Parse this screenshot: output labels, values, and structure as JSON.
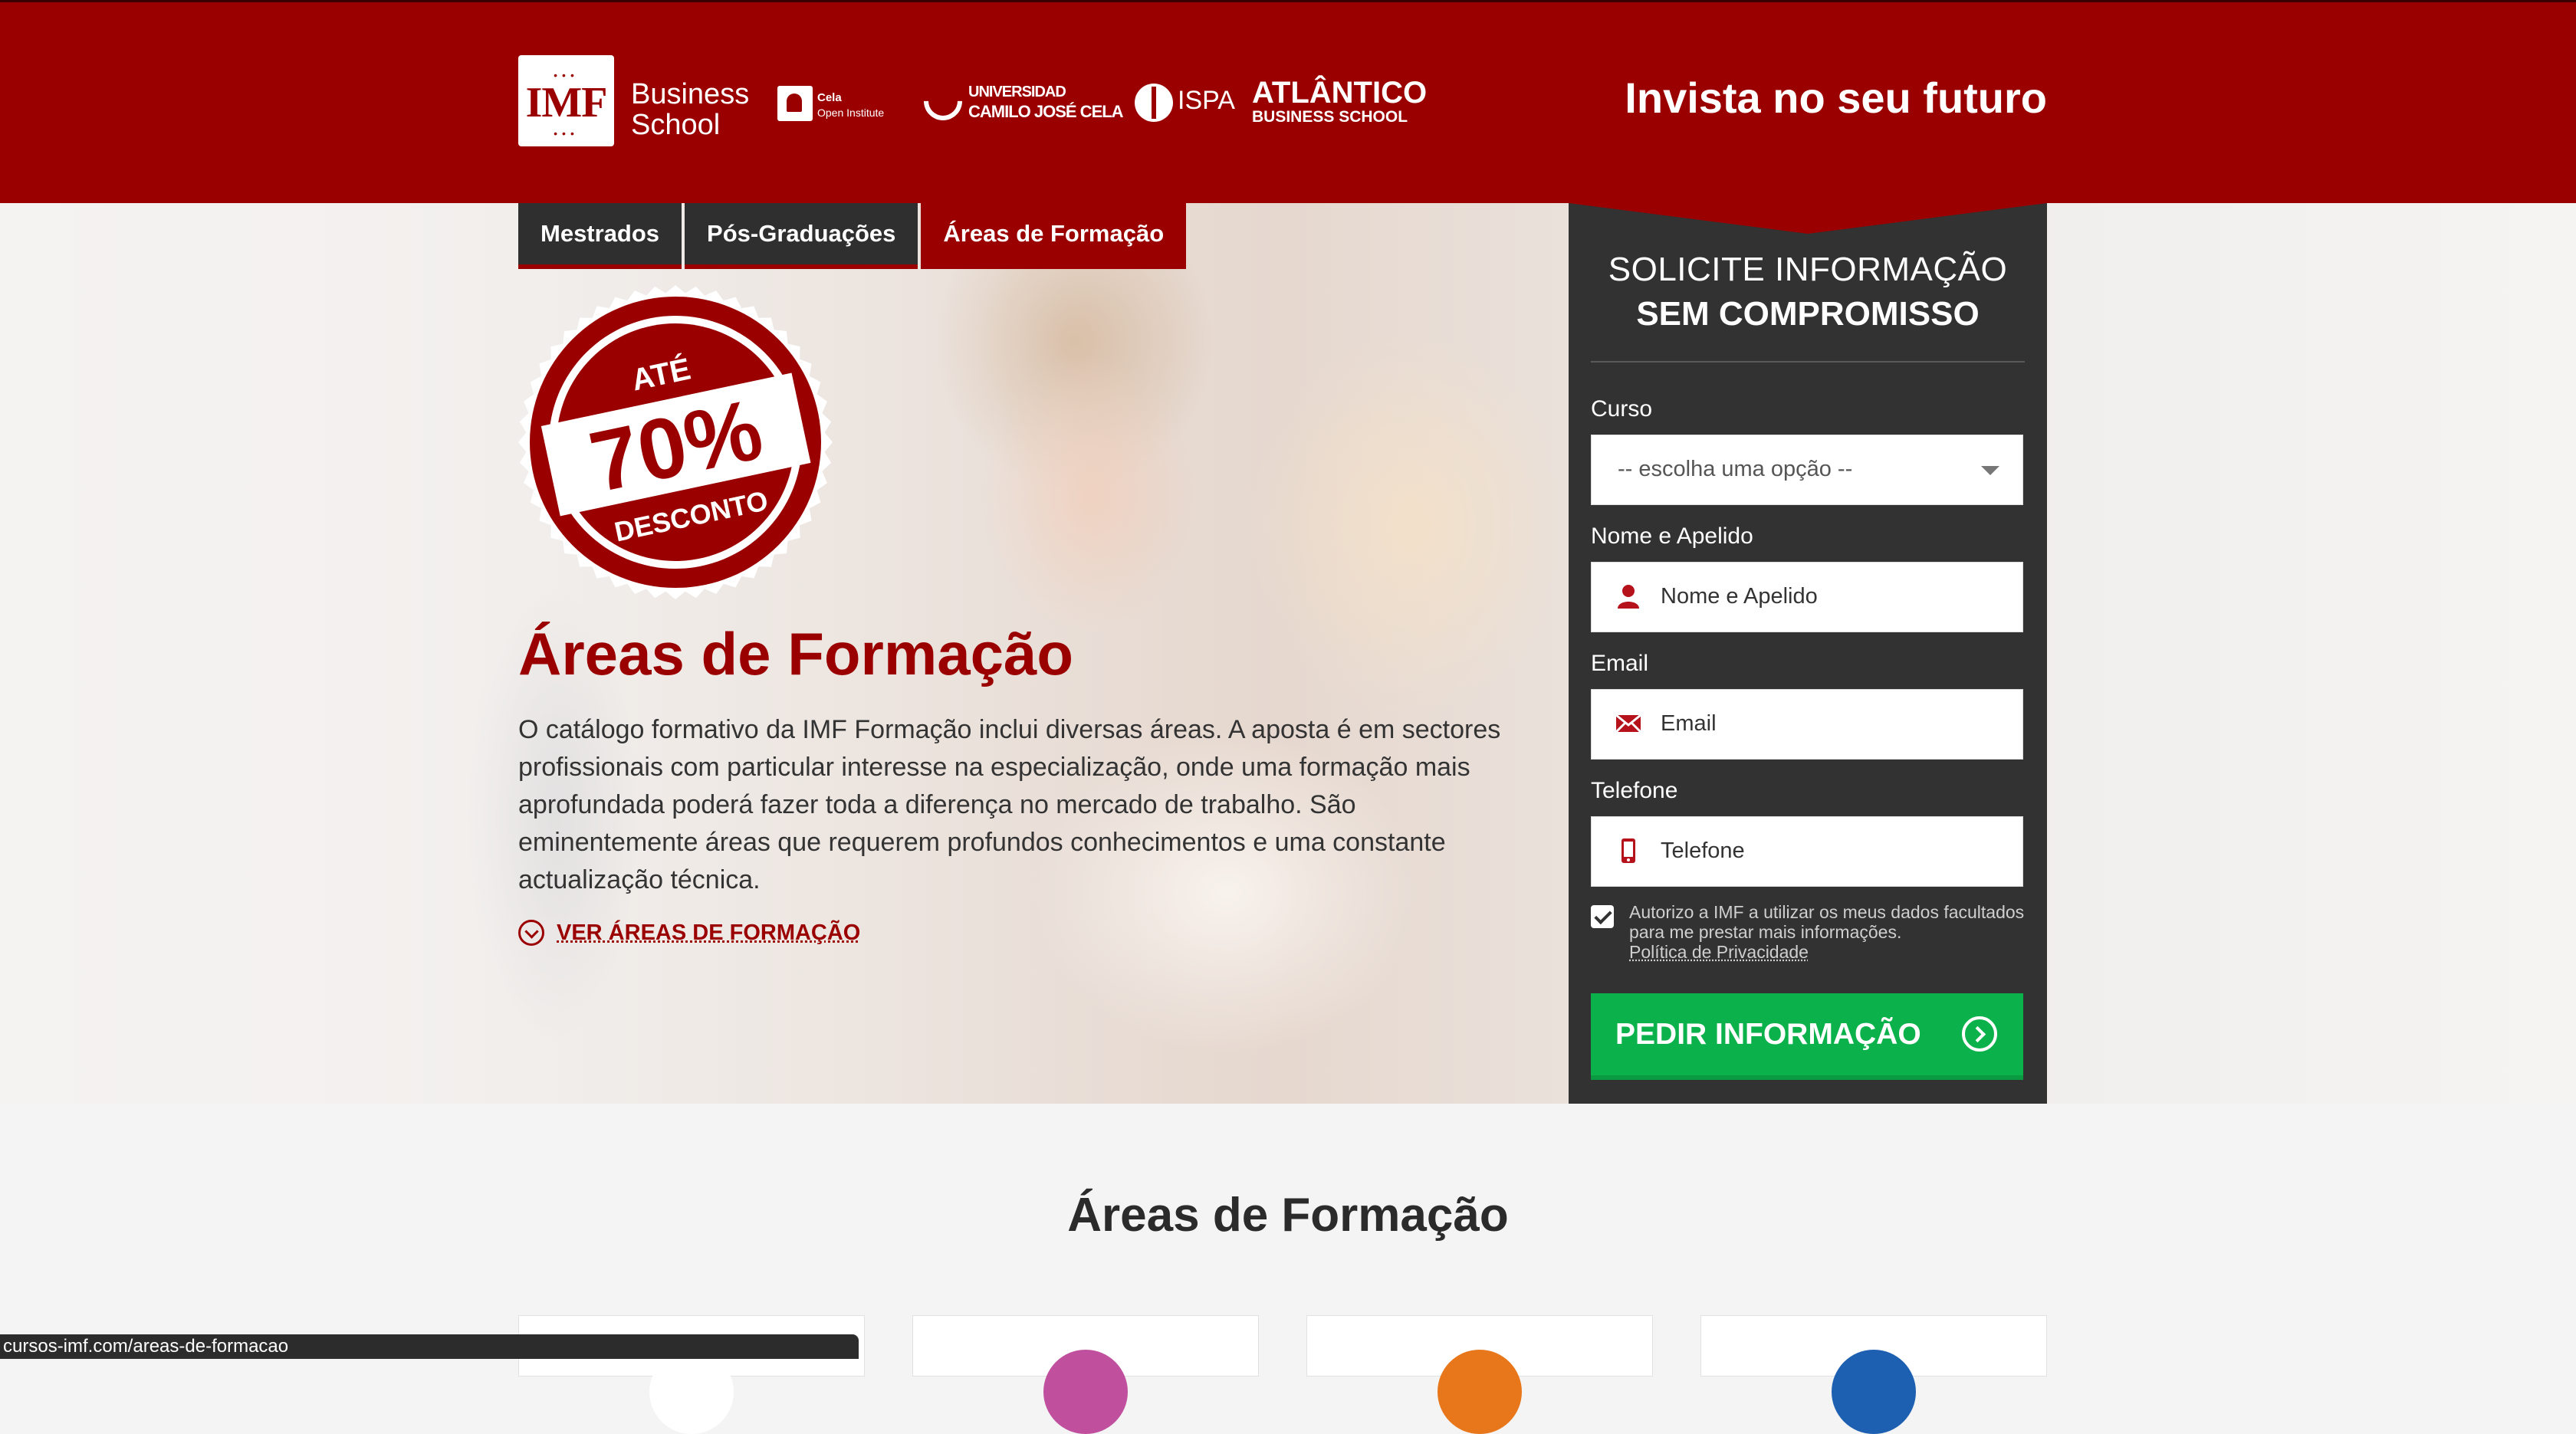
{
  "header": {
    "logos": {
      "imf": "IMF",
      "business_school": [
        "Business",
        "School"
      ],
      "cela": [
        "Cela",
        "Open Institute"
      ],
      "ucjc": [
        "UNIVERSIDAD",
        "CAMILO JOSÉ CELA"
      ],
      "ispa": "ISPA",
      "atlantico": [
        "ATLÂNTICO",
        "BUSINESS SCHOOL"
      ]
    },
    "tagline": "Invista no seu futuro",
    "brand_color": "#9b0000"
  },
  "nav": {
    "tabs": [
      {
        "label": "Mestrados",
        "active": false
      },
      {
        "label": "Pós-Graduações",
        "active": false
      },
      {
        "label": "Áreas de Formação",
        "active": true
      }
    ]
  },
  "badge": {
    "top": "ATÉ",
    "value": "70%",
    "bottom": "DESCONTO"
  },
  "hero": {
    "title": "Áreas de Formação",
    "text": "O catálogo formativo da IMF Formação inclui diversas áreas. A aposta é em sectores profissionais com particular interesse na especialização, onde uma formação mais aprofundada poderá fazer toda a diferença no mercado de trabalho. São eminentemente áreas que requerem profundos conhecimentos e uma constante actualização técnica.",
    "link": "VER ÁREAS DE FORMAÇÃO"
  },
  "form": {
    "heading_line1": "SOLICITE INFORMAÇÃO",
    "heading_line2": "SEM COMPROMISSO",
    "course_label": "Curso",
    "course_value": "-- escolha uma opção --",
    "name_label": "Nome e Apelido",
    "name_placeholder": "Nome e Apelido",
    "email_label": "Email",
    "email_placeholder": "Email",
    "phone_label": "Telefone",
    "phone_placeholder": "Telefone",
    "consent_text": "Autorizo a IMF a utilizar os meus dados facultados para me prestar mais informações.",
    "consent_checked": true,
    "privacy_link": "Política de Privacidade",
    "submit_label": "PEDIR INFORMAÇÃO",
    "submit_color": "#0bb24c"
  },
  "section": {
    "title": "Áreas de Formação",
    "card_colors": [
      "#ffffff",
      "#c0509e",
      "#e8761a",
      "#1d5fb0"
    ]
  },
  "statusbar": {
    "url": "cursos-imf.com/areas-de-formacao"
  }
}
